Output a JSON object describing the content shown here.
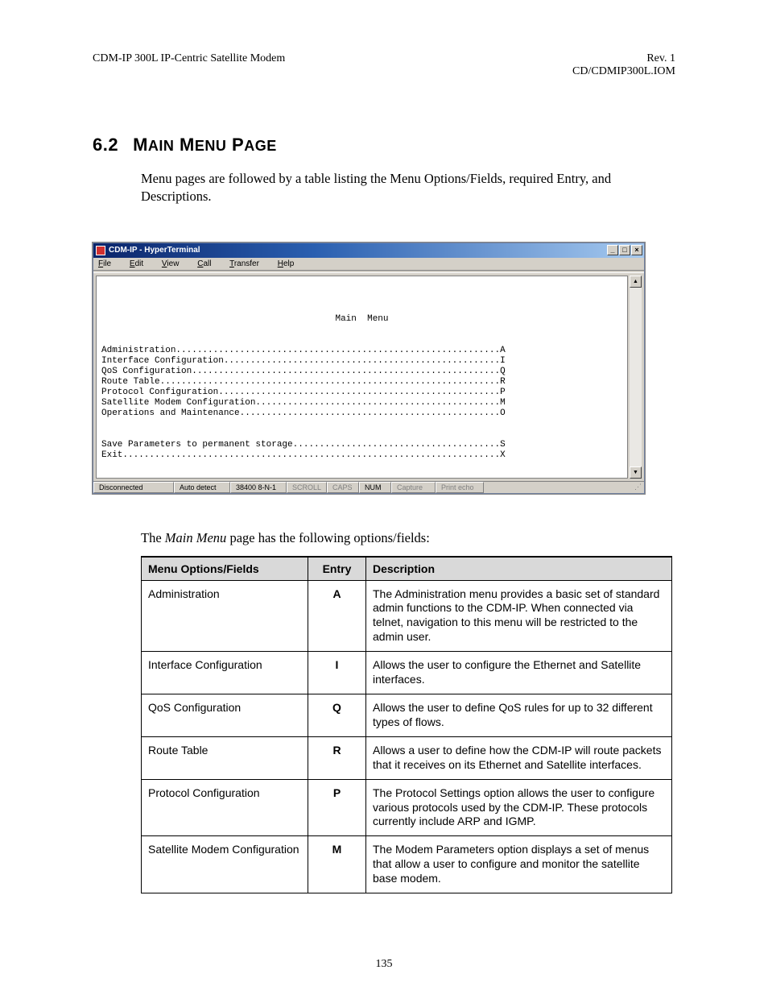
{
  "header": {
    "left": "CDM-IP 300L IP-Centric Satellite Modem",
    "right_line1": "Rev. 1",
    "right_line2": "CD/CDMIP300L.IOM"
  },
  "section": {
    "number": "6.2",
    "title_word1_cap": "M",
    "title_word1_low": "AIN",
    "title_word2_cap": "M",
    "title_word2_low": "ENU",
    "title_word3_cap": "P",
    "title_word3_low": "AGE"
  },
  "intro_text": "Menu pages are followed by a table listing the Menu Options/Fields, required Entry, and Descriptions.",
  "hyperterminal": {
    "title": "CDM-IP - HyperTerminal",
    "win_min": "_",
    "win_max": "□",
    "win_close": "×",
    "menu_file_u": "F",
    "menu_file_r": "ile",
    "menu_edit_u": "E",
    "menu_edit_r": "dit",
    "menu_view_u": "V",
    "menu_view_r": "iew",
    "menu_call_u": "C",
    "menu_call_r": "all",
    "menu_transfer_u": "T",
    "menu_transfer_r": "ransfer",
    "menu_help_u": "H",
    "menu_help_r": "elp",
    "term_title_spaced": "Main  Menu",
    "lines": {
      "l1": "Administration.............................................................A",
      "l2": "Interface Configuration....................................................I",
      "l3": "QoS Configuration..........................................................Q",
      "l4": "Route Table................................................................R",
      "l5": "Protocol Configuration.....................................................P",
      "l6": "Satellite Modem Configuration..............................................M",
      "l7": "Operations and Maintenance.................................................O",
      "l8": "Save Parameters to permanent storage.......................................S",
      "l9": "Exit.......................................................................X"
    },
    "scroll_up": "▲",
    "scroll_down": "▼",
    "status": {
      "s1": "Disconnected",
      "s2": "Auto detect",
      "s3": "38400 8-N-1",
      "s4": "SCROLL",
      "s5": "CAPS",
      "s6": "NUM",
      "s7": "Capture",
      "s8": "Print echo"
    }
  },
  "desc_sentence_pre": "The ",
  "desc_sentence_ital": "Main Menu",
  "desc_sentence_post": " page has the following options/fields:",
  "table": {
    "h1": "Menu Options/Fields",
    "h2": "Entry",
    "h3": "Description",
    "rows": [
      {
        "opt": "Administration",
        "entry": "A",
        "desc": "The Administration menu provides a basic set of standard admin functions to the CDM-IP. When connected via telnet, navigation to this menu will be restricted to the admin user."
      },
      {
        "opt": "Interface Configuration",
        "entry": "I",
        "desc": "Allows the user to configure the Ethernet and Satellite interfaces."
      },
      {
        "opt": "QoS Configuration",
        "entry": "Q",
        "desc": "Allows the user to define QoS rules for up to 32 different types of flows."
      },
      {
        "opt": "Route Table",
        "entry": "R",
        "desc": "Allows a user to define how the CDM-IP will route packets that it receives on its Ethernet and Satellite interfaces."
      },
      {
        "opt": "Protocol Configuration",
        "entry": "P",
        "desc": "The Protocol Settings option allows the user to configure various protocols used by the CDM-IP. These protocols currently include ARP and IGMP."
      },
      {
        "opt": "Satellite Modem Configuration",
        "entry": "M",
        "desc": "The Modem Parameters option displays a set of menus that allow a user to configure and monitor the satellite base modem."
      }
    ]
  },
  "page_number": "135"
}
